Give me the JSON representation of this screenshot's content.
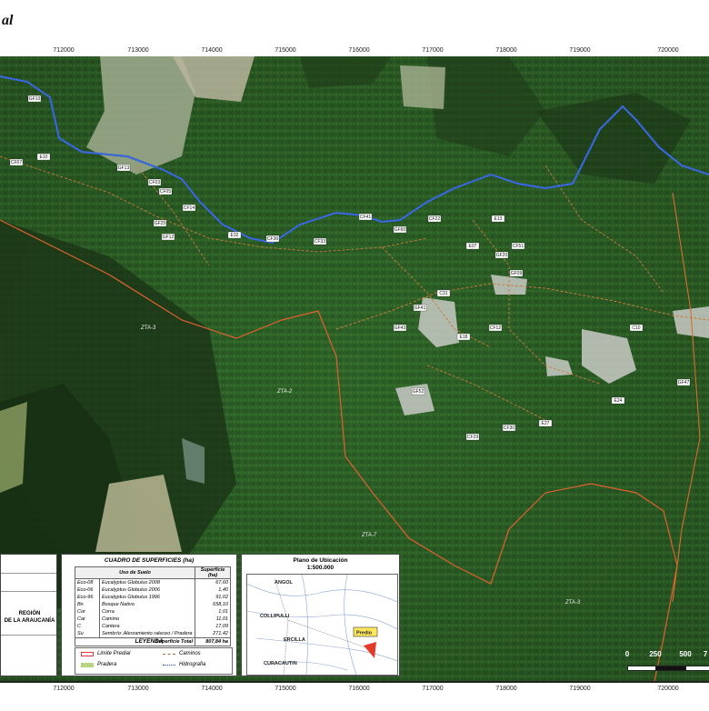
{
  "title": "al",
  "easting_ticks": [
    "712000",
    "713000",
    "714000",
    "715000",
    "716000",
    "717000",
    "718000",
    "719000",
    "720000"
  ],
  "zones": [
    "ZTA-3",
    "ZTA-2",
    "ZTA-7",
    "ZTA-3"
  ],
  "stand_labels": [
    "GF10",
    "E10",
    "CF07",
    "GF13",
    "CF03",
    "CF05",
    "CF14",
    "GF25",
    "GF12",
    "E32",
    "CF36",
    "CF33",
    "CF41",
    "GF60",
    "CF22",
    "E07",
    "E13",
    "GF20",
    "CF51",
    "C31",
    "GF41",
    "GF43",
    "E18",
    "CF12",
    "GF09",
    "C10",
    "GF47",
    "GF52",
    "CF29",
    "CF30",
    "E27",
    "E24"
  ],
  "region": {
    "line1": "REGIÓN",
    "line2": "DE LA ARAUCANÍA"
  },
  "surface_table": {
    "title": "CUADRO DE SUPERFICIES (ha)",
    "headers": [
      "Uso de Suelo",
      "Superficie (ha)"
    ],
    "rows": [
      {
        "code": "Eco-08",
        "use": "Eucalyptus Globulus 2008",
        "area": "67,60"
      },
      {
        "code": "Eco-06",
        "use": "Eucalyptus Globulus 2006",
        "area": "1,40"
      },
      {
        "code": "Eco-96",
        "use": "Eucalyptus Globulus 1996",
        "area": "91,02"
      },
      {
        "code": "Bn",
        "use": "Bosque Nativo",
        "area": "658,10"
      },
      {
        "code": "Cor",
        "use": "Corra",
        "area": "1,01"
      },
      {
        "code": "Car",
        "use": "Camino",
        "area": "11,01"
      },
      {
        "code": "C",
        "use": "Cantera",
        "area": "17,09"
      },
      {
        "code": "Su",
        "use": "Sembrío: Alerzamiento raleceo / Pradera",
        "area": "271,42"
      }
    ],
    "total_label": "Superficie Total",
    "total_value": "807,84 ha"
  },
  "legend": {
    "title": "LEYENDA",
    "items": {
      "limite": "Limite Predial",
      "caminos": "Caminos",
      "pradera": "Pradera",
      "hidro": "Hidrografia"
    }
  },
  "location": {
    "title": "Plano de Ubicación",
    "scale": "1:500.000",
    "towns": {
      "angol": "ANGOL",
      "collipulli": "COLLIPULLI",
      "ercilla": "ERCILLA",
      "curacautin": "CURACAUTIN"
    },
    "predio": "Predio"
  },
  "scale_bar": {
    "labels": [
      "0",
      "250",
      "500",
      "7"
    ]
  },
  "colors": {
    "limit": "#e34b2a",
    "road": "#c97a3e",
    "river": "#2f5fd8",
    "forest": "#2f5a26"
  }
}
